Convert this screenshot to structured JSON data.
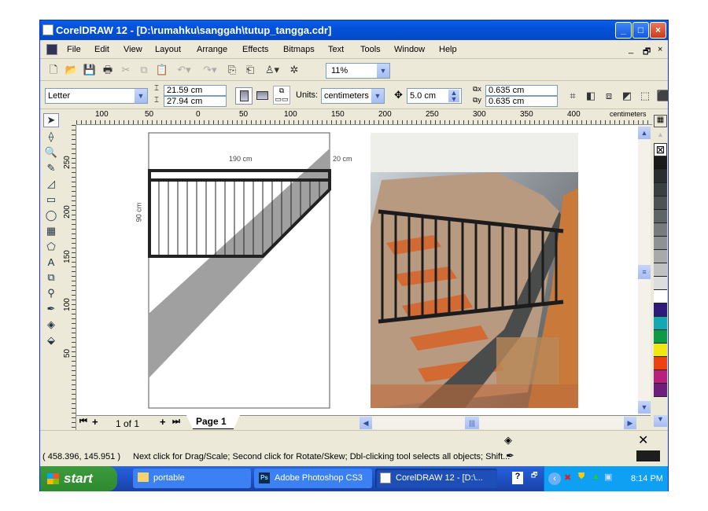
{
  "window": {
    "title": "CorelDRAW 12 - [D:\\rumahku\\sanggah\\tutup_tangga.cdr]",
    "minimize": "_",
    "maximize": "□",
    "close": "×"
  },
  "menu": [
    "File",
    "Edit",
    "View",
    "Layout",
    "Arrange",
    "Effects",
    "Bitmaps",
    "Text",
    "Tools",
    "Window",
    "Help"
  ],
  "doc_controls": [
    "_",
    "🗗",
    "×"
  ],
  "toolbar": {
    "zoom": "11%",
    "icons": [
      "new-icon",
      "open-icon",
      "save-icon",
      "print-icon",
      "cut-icon",
      "copy-icon",
      "paste-icon",
      "undo-icon",
      "redo-icon",
      "import-icon",
      "export-icon",
      "launcher-icon",
      "corel-online-icon"
    ]
  },
  "property_bar": {
    "paper": "Letter",
    "width": "21.59 cm",
    "height": "27.94 cm",
    "units_label": "Units:",
    "units": "centimeters",
    "nudge": "5.0 cm",
    "dup_x": "0.635 cm",
    "dup_y": "0.635 cm"
  },
  "ruler": {
    "top_ticks": [
      "100",
      "50",
      "0",
      "50",
      "100",
      "150",
      "200",
      "250",
      "300",
      "350",
      "400"
    ],
    "unit": "centimeters",
    "left_ticks": [
      "250",
      "200",
      "150",
      "100",
      "50"
    ]
  },
  "drawing": {
    "dim_width": "190 cm",
    "dim_depth": "20 cm",
    "dim_height": "90 cm"
  },
  "pagebar": {
    "count": "1 of 1",
    "tab": "Page 1"
  },
  "status": {
    "coords": "( 458.396, 145.951 )",
    "hint": "Next click for Drag/Scale; Second click for Rotate/Skew; Dbl-clicking tool selects all objects; Shift..."
  },
  "palette": [
    "#1a1a1a",
    "#2a2e30",
    "#3a3f42",
    "#4d5254",
    "#5f6466",
    "#777b7d",
    "#8f9294",
    "#a7a9ab",
    "#c0c1c3",
    "#dcdddf",
    "#ffffff",
    "#2e1a78",
    "#12a8b4",
    "#0e9a44",
    "#f0e80e",
    "#ee4010",
    "#b8207c",
    "#6e1e7a"
  ],
  "taskbar": {
    "start": "start",
    "tasks": [
      "portable",
      "Adobe Photoshop CS3",
      "CorelDRAW 12 - [D:\\..."
    ],
    "clock": "8:14 PM"
  }
}
